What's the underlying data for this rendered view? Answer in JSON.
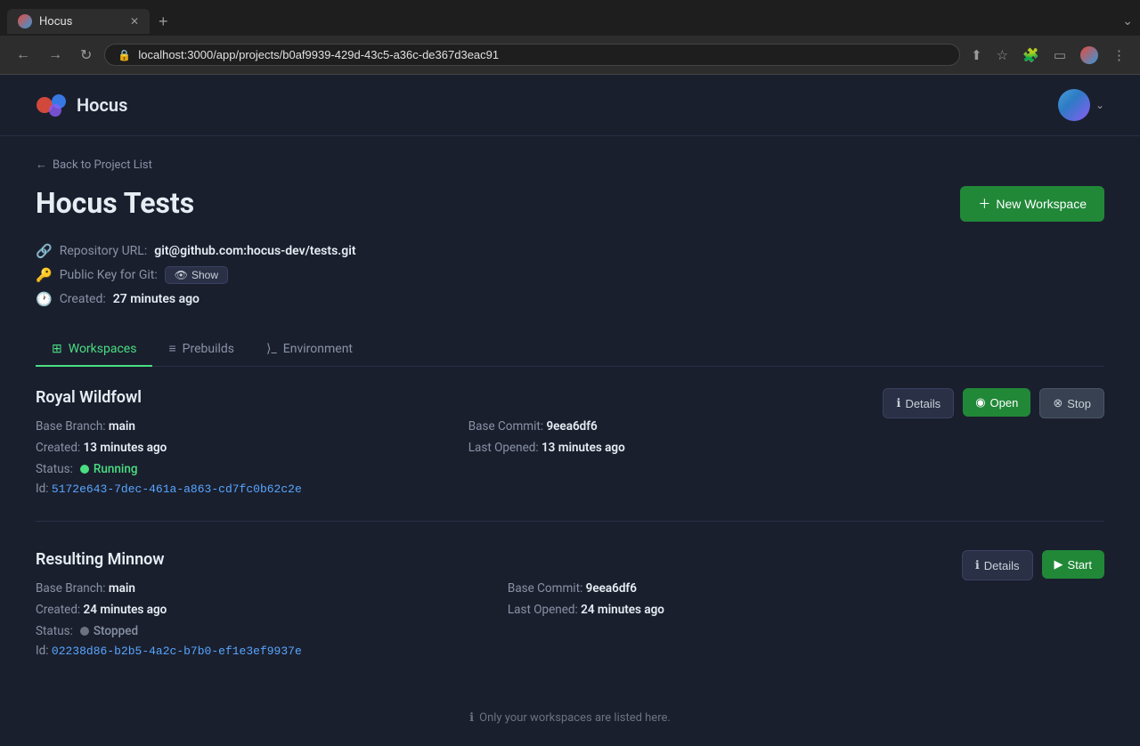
{
  "browser": {
    "tab_title": "Hocus",
    "tab_favicon_alt": "Hocus favicon",
    "new_tab_label": "+",
    "address": "localhost:3000/app/projects/b0af9939-429d-43c5-a36c-de367d3eac91",
    "chevron": "⌄"
  },
  "header": {
    "logo_text": "Hocus",
    "user_chevron": "⌄"
  },
  "nav": {
    "back_label": "Back to Project List"
  },
  "page": {
    "title": "Hocus Tests",
    "new_workspace_label": "New Workspace"
  },
  "project": {
    "repo_label": "Repository URL:",
    "repo_value": "git@github.com:hocus-dev/tests.git",
    "pubkey_label": "Public Key for Git:",
    "pubkey_show": "Show",
    "created_label": "Created:",
    "created_value": "27 minutes ago"
  },
  "tabs": [
    {
      "id": "workspaces",
      "label": "Workspaces",
      "icon": "⊞",
      "active": true
    },
    {
      "id": "prebuilds",
      "label": "Prebuilds",
      "icon": "≡",
      "active": false
    },
    {
      "id": "environment",
      "label": "Environment",
      "icon": "⟩_",
      "active": false
    }
  ],
  "workspaces": [
    {
      "name": "Royal Wildfowl",
      "base_branch_label": "Base Branch:",
      "base_branch": "main",
      "base_commit_label": "Base Commit:",
      "base_commit": "9eea6df6",
      "created_label": "Created:",
      "created": "13 minutes ago",
      "last_opened_label": "Last Opened:",
      "last_opened": "13 minutes ago",
      "status_label": "Status:",
      "status": "Running",
      "status_type": "running",
      "id_label": "Id:",
      "id": "5172e643-7dec-461a-a863-cd7fc0b62c2e",
      "actions": [
        "Details",
        "Open",
        "Stop"
      ]
    },
    {
      "name": "Resulting Minnow",
      "base_branch_label": "Base Branch:",
      "base_branch": "main",
      "base_commit_label": "Base Commit:",
      "base_commit": "9eea6df6",
      "created_label": "Created:",
      "created": "24 minutes ago",
      "last_opened_label": "Last Opened:",
      "last_opened": "24 minutes ago",
      "status_label": "Status:",
      "status": "Stopped",
      "status_type": "stopped",
      "id_label": "Id:",
      "id": "02238d86-b2b5-4a2c-b7b0-ef1e3ef9937e",
      "actions": [
        "Details",
        "Start"
      ]
    }
  ],
  "footer": {
    "note": "Only your workspaces are listed here."
  }
}
